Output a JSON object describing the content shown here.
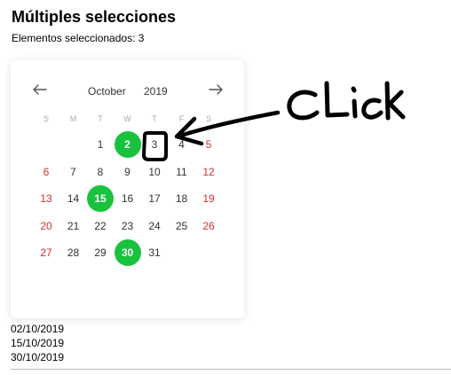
{
  "header": {
    "title": "Múltiples selecciones",
    "subtitle": "Elementos seleccionados: 3"
  },
  "calendar": {
    "month": "October",
    "year": "2019",
    "prev_icon": "arrow-left-icon",
    "next_icon": "arrow-right-icon",
    "weekdays": [
      "S",
      "M",
      "T",
      "W",
      "T",
      "F",
      "S"
    ],
    "first_weekday_index": 2,
    "days_in_month": 31,
    "selected_days": [
      2,
      15,
      30
    ],
    "accent_color": "#18c23d",
    "weekend_color": "#d32f2f"
  },
  "selected_dates": [
    "02/10/2019",
    "15/10/2019",
    "30/10/2019"
  ],
  "annotation": {
    "text": "Click",
    "highlighted_day": 3
  }
}
